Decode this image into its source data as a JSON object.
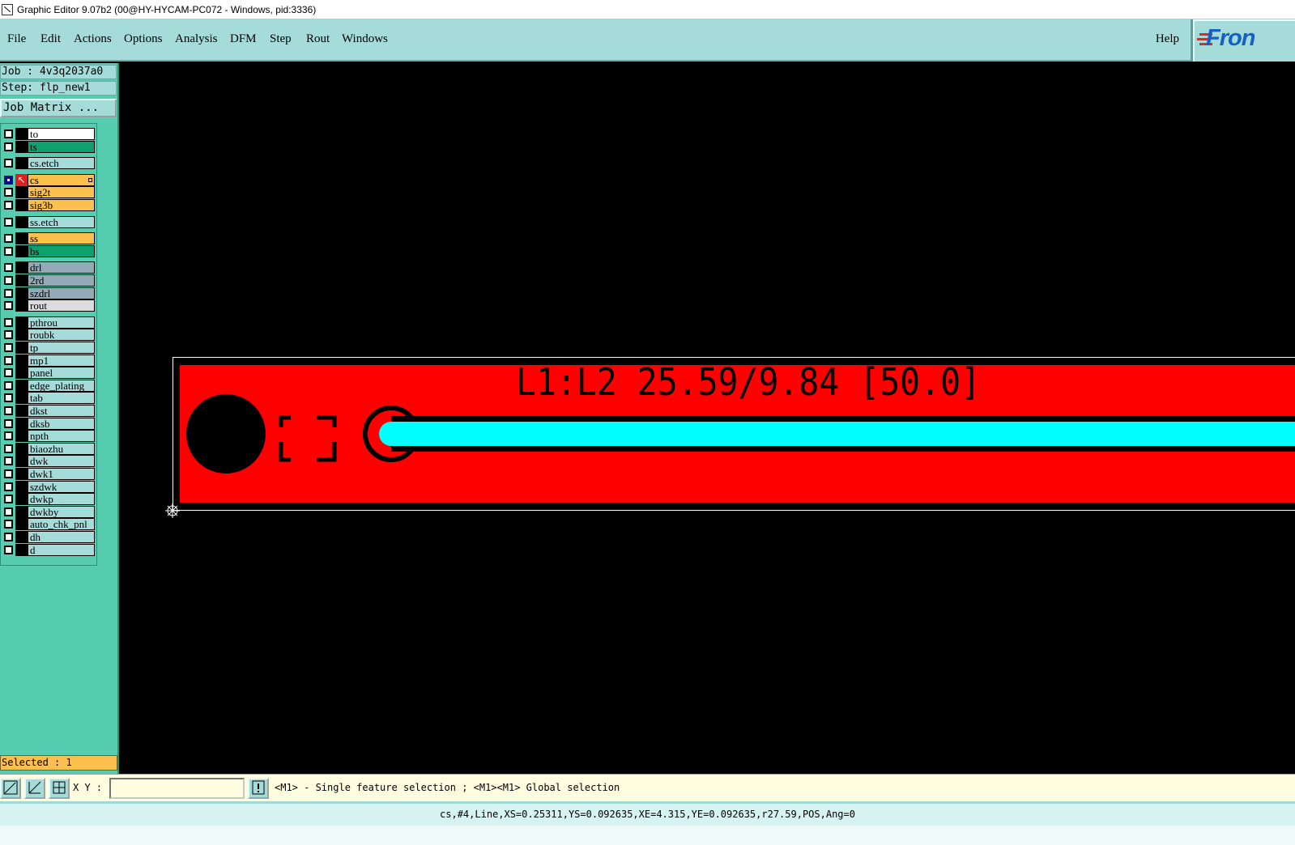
{
  "window": {
    "title": "Graphic Editor 9.07b2 (00@HY-HYCAM-PC072 - Windows, pid:3336)"
  },
  "menu": {
    "items": [
      "File",
      "Edit",
      "Actions",
      "Options",
      "Analysis",
      "DFM",
      "Step",
      "Rout",
      "Windows"
    ],
    "help": "Help"
  },
  "logo": {
    "text": "Fron"
  },
  "job": {
    "label": "Job : 4v3q2037a0",
    "step": "Step: flp_new1",
    "matrix_button": "Job Matrix ..."
  },
  "layers": [
    {
      "name": "to",
      "color": "#ffffff"
    },
    {
      "name": "ts",
      "color": "#10a070"
    },
    {
      "name": "cs.etch",
      "color": "#a5dcda"
    },
    {
      "name": "cs",
      "color": "#fbc04e",
      "active": true
    },
    {
      "name": "sig2t",
      "color": "#fbc04e"
    },
    {
      "name": "sig3b",
      "color": "#fbc04e"
    },
    {
      "name": "ss.etch",
      "color": "#a5dcda"
    },
    {
      "name": "ss",
      "color": "#fbc04e"
    },
    {
      "name": "bs",
      "color": "#10a070"
    },
    {
      "name": "drl",
      "color": "#94abb7"
    },
    {
      "name": "2rd",
      "color": "#94abb7"
    },
    {
      "name": "szdrl",
      "color": "#94abb7"
    },
    {
      "name": "rout",
      "color": "#dcdcdc"
    },
    {
      "name": "pthrou",
      "color": "#a5dcda"
    },
    {
      "name": "roubk",
      "color": "#a5dcda"
    },
    {
      "name": "tp",
      "color": "#a5dcda"
    },
    {
      "name": "mp1",
      "color": "#a5dcda"
    },
    {
      "name": "panel",
      "color": "#a5dcda"
    },
    {
      "name": "edge_plating",
      "color": "#a5dcda"
    },
    {
      "name": "tab",
      "color": "#a5dcda"
    },
    {
      "name": "dkst",
      "color": "#a5dcda"
    },
    {
      "name": "dksb",
      "color": "#a5dcda"
    },
    {
      "name": "npth",
      "color": "#a5dcda"
    },
    {
      "name": "biaozhu",
      "color": "#a5dcda"
    },
    {
      "name": "dwk",
      "color": "#a5dcda"
    },
    {
      "name": "dwk1",
      "color": "#a5dcda"
    },
    {
      "name": "szdwk",
      "color": "#a5dcda"
    },
    {
      "name": "dwkp",
      "color": "#a5dcda"
    },
    {
      "name": "dwkby",
      "color": "#a5dcda"
    },
    {
      "name": "auto_chk_pnl",
      "color": "#a5dcda"
    },
    {
      "name": "dh",
      "color": "#a5dcda"
    },
    {
      "name": "d",
      "color": "#a5dcda"
    }
  ],
  "selected": "Selected : 1",
  "canvas": {
    "annotation": "L1:L2 25.59/9.84 [50.0]"
  },
  "toolbar": {
    "xy_label": "X Y :",
    "xy_value": "",
    "hint": "<M1> - Single feature selection ; <M1><M1> Global selection"
  },
  "status": "cs,#4,Line,XS=0.25311,YS=0.092635,XE=4.315,YE=0.092635,r27.59,POS,Ang=0",
  "colors": {
    "panel_bg": "#56cdb0",
    "menu_bg": "#a5dcda",
    "copper": "#ff0000",
    "selected_feature": "#00ffff",
    "status_bg": "#d6f3f2"
  },
  "icons": [
    "app-icon",
    "window-fit-icon",
    "zoom-icon",
    "grid-snap-icon",
    "alert-icon",
    "origin-icon"
  ]
}
